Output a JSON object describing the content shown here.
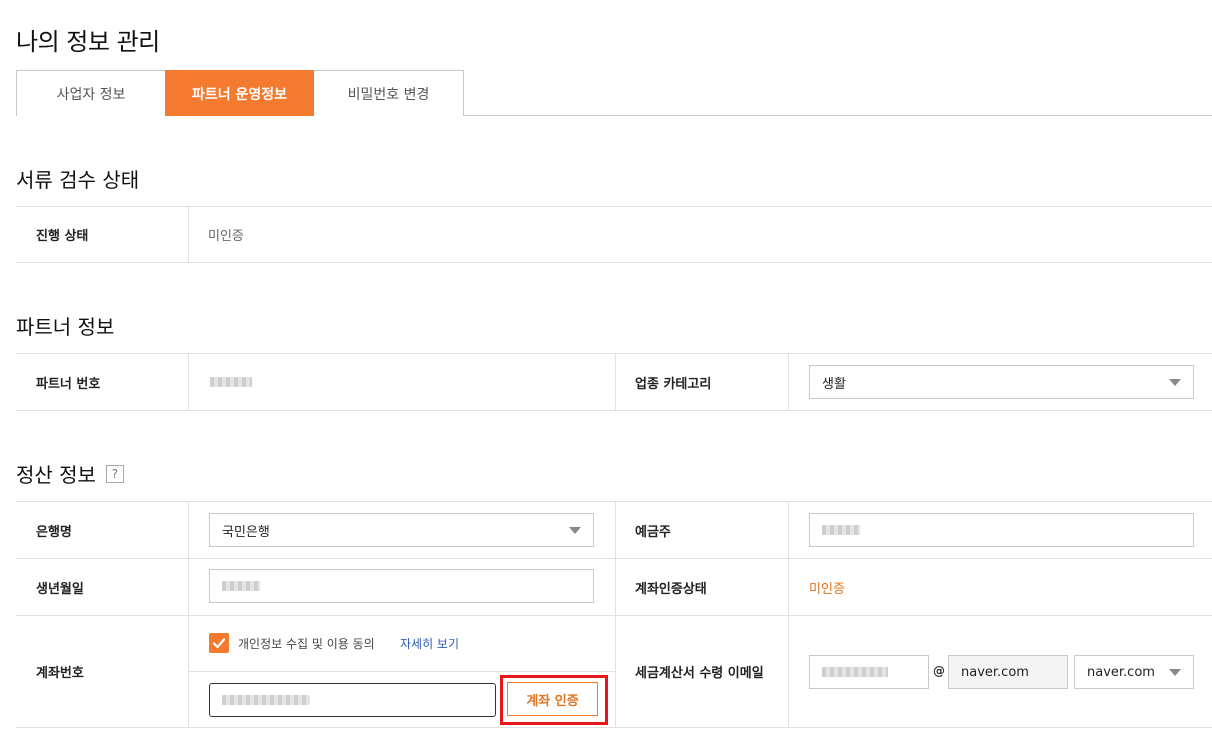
{
  "page": {
    "title": "나의 정보 관리"
  },
  "tabs": [
    {
      "label": "사업자 정보",
      "active": false
    },
    {
      "label": "파트너 운영정보",
      "active": true
    },
    {
      "label": "비밀번호 변경",
      "active": false
    }
  ],
  "review": {
    "title": "서류 검수 상태",
    "status_label": "진행 상태",
    "status_value": "미인증"
  },
  "partner": {
    "title": "파트너 정보",
    "number_label": "파트너 번호",
    "category_label": "업종 카테고리",
    "category_value": "생활"
  },
  "settlement": {
    "title": "정산 정보",
    "help": "?",
    "bank_label": "은행명",
    "bank_value": "국민은행",
    "holder_label": "예금주",
    "birth_label": "생년월일",
    "verify_status_label": "계좌인증상태",
    "verify_status_value": "미인증",
    "account_label": "계좌번호",
    "consent_text": "개인정보 수집 및 이용 동의",
    "consent_link": "자세히 보기",
    "verify_button": "계좌 인증",
    "email_label": "세금계산서 수령 이메일",
    "email_at": "@",
    "email_domain": "naver.com",
    "email_domain_select": "naver.com"
  },
  "colors": {
    "accent": "#f47a2f",
    "highlight": "#e8141b",
    "link": "#2b5bb5"
  }
}
